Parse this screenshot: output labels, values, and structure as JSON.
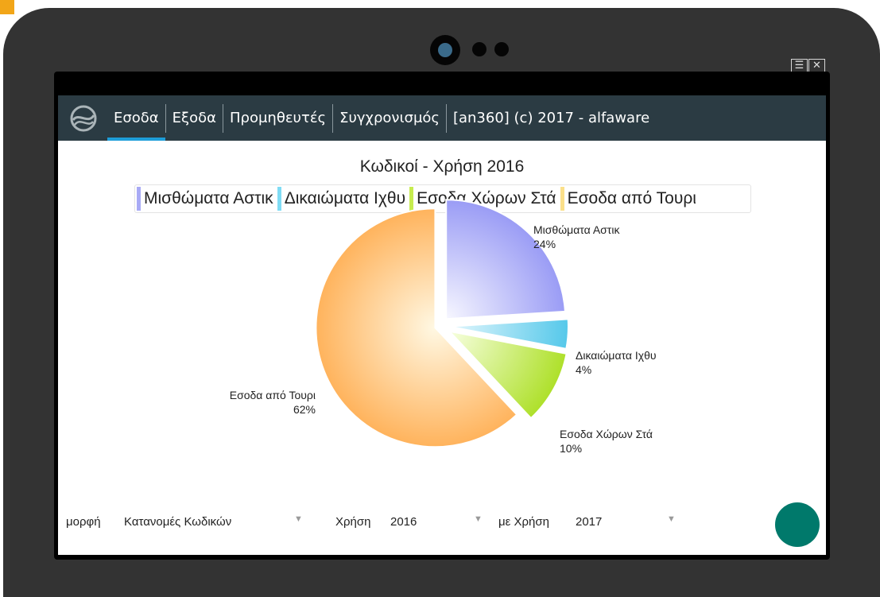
{
  "tabs": [
    {
      "label": "Εσοδα",
      "active": true
    },
    {
      "label": "Εξοδα",
      "active": false
    },
    {
      "label": "Προμηθευτές",
      "active": false
    },
    {
      "label": "Συγχρονισμός",
      "active": false
    },
    {
      "label": "[an360] (c) 2017 - alfaware",
      "active": false
    }
  ],
  "window_controls": {
    "menu_icon": "hamburger-menu-icon",
    "close_icon": "close-icon"
  },
  "chart": {
    "title": "Κωδικοί - Χρήση 2016",
    "legend": [
      {
        "label": "Μισθώματα Αστικ",
        "color": "#a8aaf5"
      },
      {
        "label": "Δικαιώματα Ιχθυ",
        "color": "#7fdcf5"
      },
      {
        "label": "Εσοδα Χώρων Στά",
        "color": "#c6ec4f"
      },
      {
        "label": "Εσοδα από Τουρι",
        "color": "#fbe08a"
      }
    ]
  },
  "chart_data": {
    "type": "pie",
    "title": "Κωδικοί - Χρήση 2016",
    "categories": [
      "Μισθώματα Αστικ",
      "Δικαιώματα Ιχθυ",
      "Εσοδα Χώρων Στά",
      "Εσοδα από Τουρι"
    ],
    "values": [
      24,
      4,
      10,
      62
    ],
    "value_labels": [
      "24%",
      "4%",
      "10%",
      "62%"
    ],
    "colors": [
      "#9a9cf5",
      "#55c8ea",
      "#aee02a",
      "#ffb35c"
    ],
    "legend_position": "top"
  },
  "filters": {
    "form_label": "μορφή",
    "form_value": "Κατανομές Κωδικών",
    "year_label": "Χρήση",
    "year_value": "2016",
    "compare_label": "με Χρήση",
    "compare_value": "2017"
  },
  "fab": {
    "color": "#00796b"
  }
}
